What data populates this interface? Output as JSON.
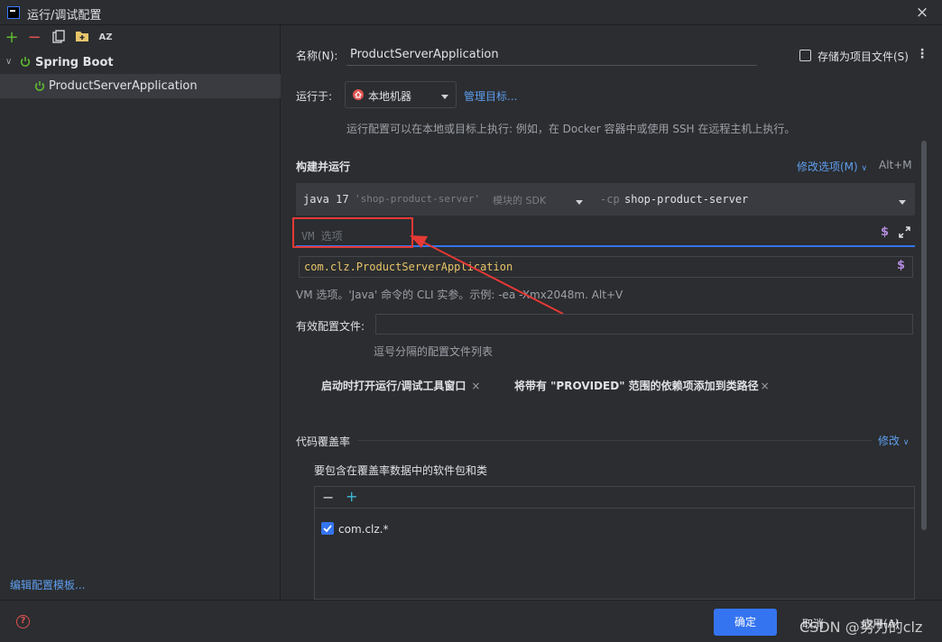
{
  "window": {
    "title": "运行/调试配置",
    "close_label": "×"
  },
  "toolbar": {
    "add": "+",
    "remove": "−",
    "sort": "AZ"
  },
  "tree": {
    "root": {
      "label": "Spring Boot",
      "expander": "∨"
    },
    "child": {
      "label": "ProductServerApplication"
    }
  },
  "left_footer": {
    "edit_templates": "编辑配置模板..."
  },
  "form": {
    "name_label": "名称(N):",
    "name_value": "ProductServerApplication",
    "store_as_project_file": "存储为项目文件(S)",
    "run_on_label": "运行于:",
    "run_on_value": "本地机器",
    "manage_targets": "管理目标...",
    "run_on_hint": "运行配置可以在本地或目标上执行: 例如，在 Docker 容器中或使用 SSH 在远程主机上执行。"
  },
  "build_run": {
    "section_title": "构建并运行",
    "modify_options": "修改选项(M)",
    "modify_shortcut": "Alt+M",
    "jdk_bold": "java 17",
    "jdk_module": "'shop-product-server'",
    "jdk_module_suffix": "模块的 SDK",
    "cp_flag": "-cp",
    "cp_value": "shop-product-server",
    "vm_placeholder": "VM 选项",
    "main_class": "com.clz.ProductServerApplication",
    "vm_hint": "VM 选项。'Java' 命令的 CLI 实参。示例: -ea -Xmx2048m. Alt+V",
    "profiles_label": "有效配置文件:",
    "profiles_hint": "逗号分隔的配置文件列表",
    "chips": [
      {
        "label": "启动时打开运行/调试工具窗口",
        "remove": "×"
      },
      {
        "label": "将带有 \"PROVIDED\" 范围的依赖项添加到类路径",
        "remove": "×"
      }
    ]
  },
  "coverage": {
    "section_title": "代码覆盖率",
    "modify": "修改",
    "include_label": "要包含在覆盖率数据中的软件包和类",
    "toolbar_remove": "−",
    "toolbar_add": "+",
    "items": [
      {
        "label": "com.clz.*",
        "checked": true
      }
    ]
  },
  "footer": {
    "ok": "确定",
    "cancel": "取消",
    "apply": "应用(A)",
    "watermark": "CSDN @努力的clz"
  },
  "colors": {
    "accent": "#3574f0",
    "link": "#5e9eef",
    "highlight_box": "#e53935",
    "mono_accent": "#e8c46a",
    "run_icon_green": "#5fb832"
  }
}
